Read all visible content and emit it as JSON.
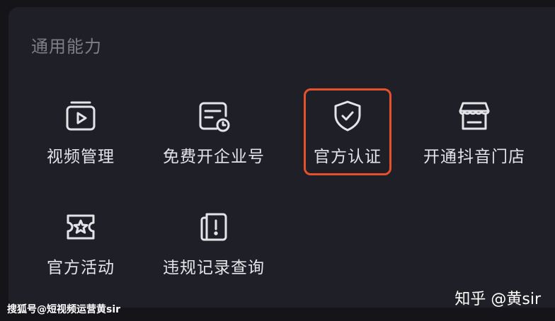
{
  "section": {
    "title": "通用能力"
  },
  "items": [
    {
      "label": "视频管理",
      "icon": "video-folder-icon"
    },
    {
      "label": "免费开企业号",
      "icon": "enterprise-clock-icon"
    },
    {
      "label": "官方认证",
      "icon": "shield-check-icon",
      "highlighted": true
    },
    {
      "label": "开通抖音门店",
      "icon": "storefront-icon"
    },
    {
      "label": "官方活动",
      "icon": "star-ticket-icon"
    },
    {
      "label": "违规记录查询",
      "icon": "violation-record-icon"
    }
  ],
  "colors": {
    "background": "#141419",
    "panel": "#1f1f27",
    "title": "#7e7f86",
    "label": "#e4e4e8",
    "highlight": "#e5502d"
  },
  "watermarks": {
    "left": "搜狐号@短视频运营黄sir",
    "right": "知乎 @黄sir"
  }
}
